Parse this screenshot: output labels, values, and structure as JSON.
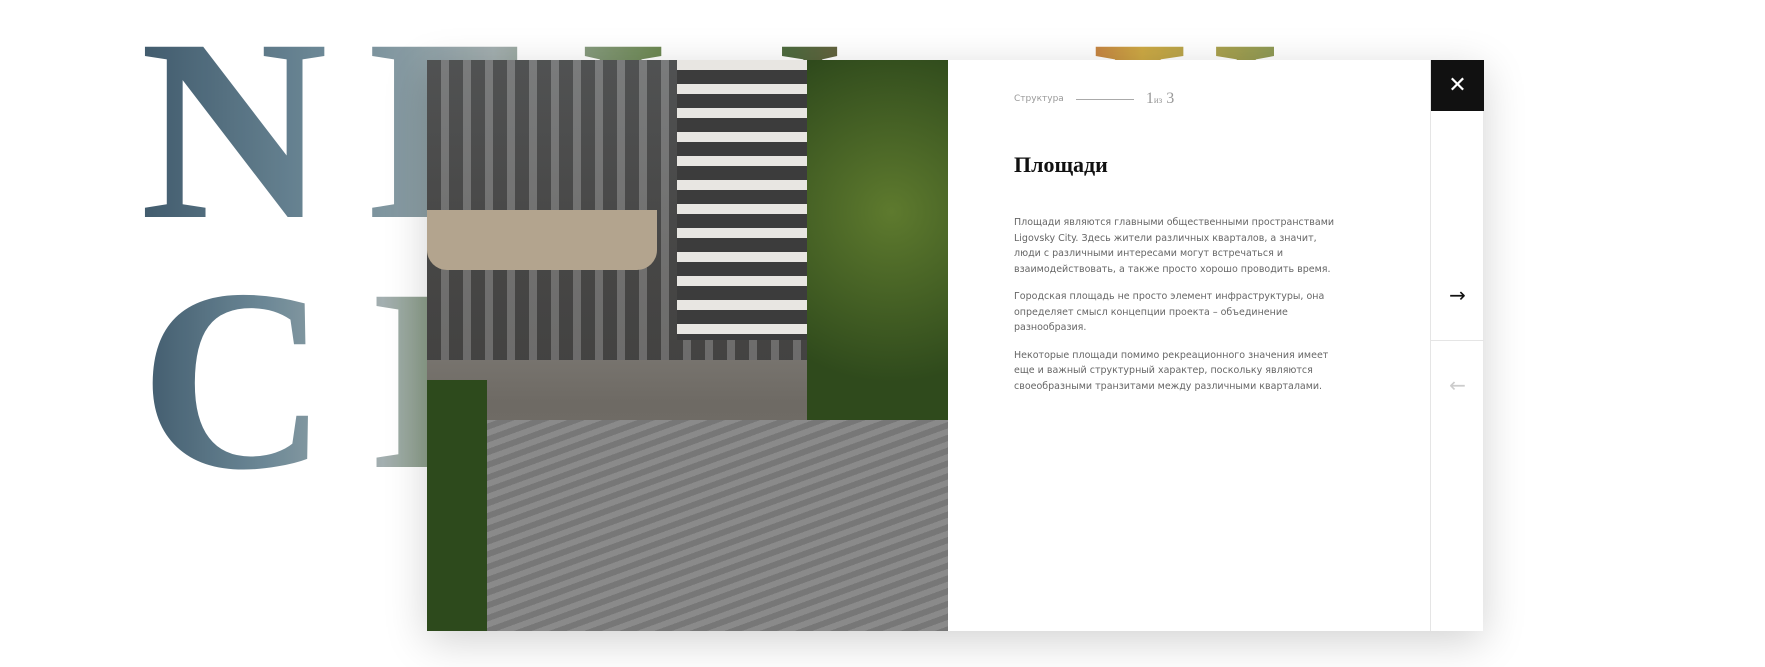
{
  "background_lettering": [
    "NEW",
    "CITY"
  ],
  "modal": {
    "breadcrumb_label": "Структура",
    "counter_current": "1",
    "counter_sep": "из",
    "counter_total": "3",
    "title": "Площади",
    "paragraphs": [
      "Площади являются главными общественными пространствами Ligovsky City. Здесь жители различных кварталов, а значит, люди с различными интересами могут встречаться и взаимодействовать, а также просто хорошо проводить время.",
      "Городская площадь не просто элемент инфраструктуры, она определяет смысл концепции проекта – объединение разнообразия.",
      "Некоторые площади помимо рекреационного значения имеет еще и важный структурный характер, поскольку являются своеобразными транзитами между различными кварталами."
    ],
    "close_icon": "✕",
    "next_icon": "→",
    "prev_icon": "←"
  }
}
